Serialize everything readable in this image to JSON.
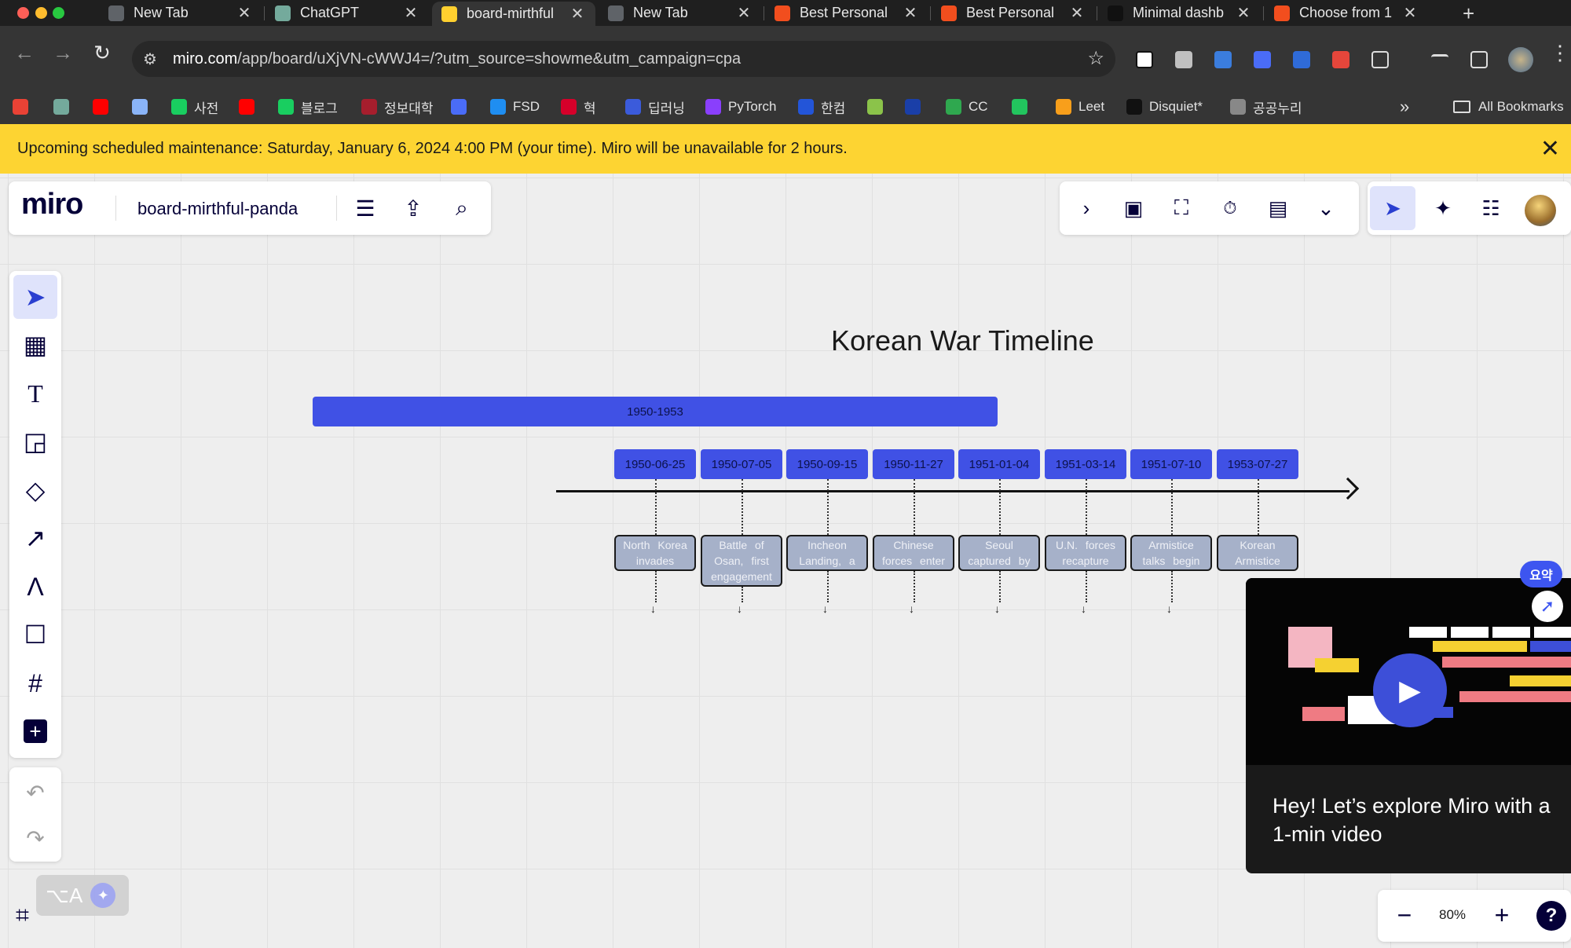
{
  "browser": {
    "tabs": [
      {
        "title": "New Tab",
        "color": "#5f6368"
      },
      {
        "title": "ChatGPT",
        "color": "#74aa9c"
      },
      {
        "title": "board-mirthful",
        "color": "#ffd02f"
      },
      {
        "title": "New Tab",
        "color": "#5f6368"
      },
      {
        "title": "Best Personal",
        "color": "#f24e1e"
      },
      {
        "title": "Best Personal",
        "color": "#f24e1e"
      },
      {
        "title": "Minimal dashb",
        "color": "#111111"
      },
      {
        "title": "Choose from 1",
        "color": "#f24e1e"
      }
    ],
    "new_tab_label": "+",
    "url_domain": "miro.com",
    "url_path": "/app/board/uXjVN-cWWJ4=/?utm_source=showme&utm_campaign=cpa",
    "bookmarks": [
      {
        "label": "",
        "color": "#e94235"
      },
      {
        "label": "",
        "color": "#74aa9c"
      },
      {
        "label": "",
        "color": "#ff0000"
      },
      {
        "label": "",
        "color": "#8ab4f8"
      },
      {
        "label": "사전",
        "color": "#19ce60"
      },
      {
        "label": "",
        "color": "#ff0000"
      },
      {
        "label": "블로그",
        "color": "#19ce60"
      },
      {
        "label": "정보대학",
        "color": "#a61e2d"
      },
      {
        "label": "",
        "color": "#4a6cf7"
      },
      {
        "label": "FSD",
        "color": "#1f8ef1"
      },
      {
        "label": "혁",
        "color": "#d6002a"
      },
      {
        "label": "딥러닝",
        "color": "#3b5bdb"
      },
      {
        "label": "PyTorch",
        "color": "#8a3ffc"
      },
      {
        "label": "한컴",
        "color": "#2355d8"
      },
      {
        "label": "",
        "color": "#8bc34a"
      },
      {
        "label": "",
        "color": "#1a3fa8"
      },
      {
        "label": "CC",
        "color": "#2fa84f"
      },
      {
        "label": "",
        "color": "#22c55e"
      },
      {
        "label": "Leet",
        "color": "#f89f1b"
      },
      {
        "label": "Disquiet*",
        "color": "#111111"
      },
      {
        "label": "공공누리",
        "color": "#888888"
      }
    ],
    "all_bookmarks_label": "All Bookmarks"
  },
  "banner": {
    "text": "Upcoming scheduled maintenance: Saturday, January 6, 2024 4:00 PM (your time). Miro will be unavailable for 2 hours.",
    "close_label": "✕"
  },
  "board": {
    "logo": "miro",
    "name": "board-mirthful-panda",
    "title": "Korean War Timeline",
    "period": "1950-1953",
    "events": [
      {
        "date": "1950-06-25",
        "text": "North Korea invades"
      },
      {
        "date": "1950-07-05",
        "text": "Battle of Osan, first engagement"
      },
      {
        "date": "1950-09-15",
        "text": "Incheon Landing, a"
      },
      {
        "date": "1950-11-27",
        "text": "Chinese forces enter"
      },
      {
        "date": "1951-01-04",
        "text": "Seoul captured by"
      },
      {
        "date": "1951-03-14",
        "text": "U.N. forces recapture"
      },
      {
        "date": "1951-07-10",
        "text": "Armistice talks begin"
      },
      {
        "date": "1953-07-27",
        "text": "Korean Armistice"
      }
    ]
  },
  "video": {
    "caption": "Hey! Let’s explore Miro with a 1-min video",
    "summary_badge": "요약"
  },
  "zoom": {
    "value": "80%",
    "minus": "−",
    "plus": "+",
    "help": "?"
  },
  "shortcut_chip": "⌥A"
}
